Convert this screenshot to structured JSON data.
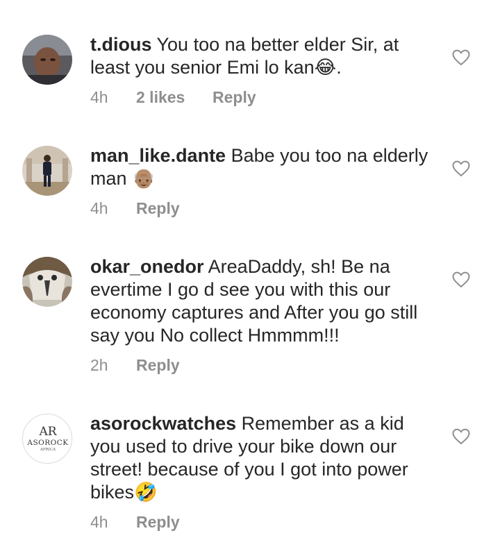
{
  "comments": [
    {
      "username": "t.dious",
      "text": "You too na better elder Sir, at least you senior Emi lo kan",
      "emoji": "😂",
      "text_after": ".",
      "time": "4h",
      "likes": "2 likes",
      "reply": "Reply"
    },
    {
      "username": "man_like.dante",
      "text": "Babe you too na elderly man",
      "emoji": "👴🏽",
      "text_after": "",
      "time": "4h",
      "reply": "Reply"
    },
    {
      "username": "okar_onedor",
      "text": "AreaDaddy, sh! Be na evertime I go d see you with this our economy captures and After you go still say you No collect Hmmmm!!!",
      "time": "2h",
      "reply": "Reply"
    },
    {
      "username": "asorockwatches",
      "text": "Remember as a kid you used to drive your bike down our street! because of you I got into power bikes",
      "emoji": "🤣",
      "text_after": "",
      "time": "4h",
      "reply": "Reply",
      "avatar_logo": {
        "mark": "AR",
        "name": "ASOROCK",
        "sub": "AFRICA"
      }
    }
  ],
  "icons": {
    "like": "heart-outline-icon"
  },
  "colors": {
    "text": "#262626",
    "meta": "#8e8e8e",
    "heart": "#8e8e8e"
  }
}
